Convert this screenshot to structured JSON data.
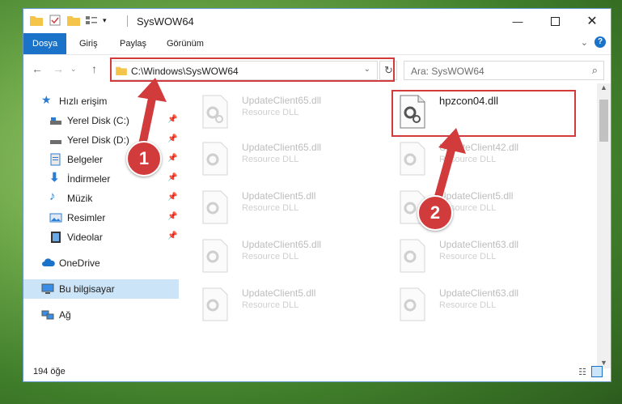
{
  "window": {
    "title": "SysWOW64"
  },
  "ribbon": {
    "tabs": [
      {
        "label": "Dosya"
      },
      {
        "label": "Giriş"
      },
      {
        "label": "Paylaş"
      },
      {
        "label": "Görünüm"
      }
    ]
  },
  "address": {
    "path": "C:\\Windows\\SysWOW64"
  },
  "search": {
    "placeholder": "Ara: SysWOW64"
  },
  "sidebar": {
    "items": [
      {
        "label": "Hızlı erişim",
        "icon": "star-icon"
      },
      {
        "label": "Yerel Disk (C:)",
        "icon": "drive-icon"
      },
      {
        "label": "Yerel Disk (D:)",
        "icon": "drive-icon"
      },
      {
        "label": "Belgeler",
        "icon": "documents-icon"
      },
      {
        "label": "İndirmeler",
        "icon": "download-icon"
      },
      {
        "label": "Müzik",
        "icon": "music-icon"
      },
      {
        "label": "Resimler",
        "icon": "pictures-icon"
      },
      {
        "label": "Videolar",
        "icon": "videos-icon"
      },
      {
        "label": "OneDrive",
        "icon": "cloud-icon"
      },
      {
        "label": "Bu bilgisayar",
        "icon": "computer-icon"
      },
      {
        "label": "Ağ",
        "icon": "network-icon"
      }
    ]
  },
  "files": [
    {
      "name": "UpdateClient65.dll",
      "type": "Resource DLL"
    },
    {
      "name": "hpzcon04.dll",
      "type": ""
    },
    {
      "name": "UpdateClient65.dll",
      "type": "Resource DLL"
    },
    {
      "name": "UpdateClient42.dll",
      "type": "Resource DLL"
    },
    {
      "name": "UpdateClient5.dll",
      "type": "Resource DLL"
    },
    {
      "name": "UpdateClient5.dll",
      "type": "Resource DLL"
    },
    {
      "name": "UpdateClient65.dll",
      "type": "Resource DLL"
    },
    {
      "name": "UpdateClient63.dll",
      "type": "Resource DLL"
    },
    {
      "name": "UpdateClient5.dll",
      "type": "Resource DLL"
    },
    {
      "name": "UpdateClient63.dll",
      "type": "Resource DLL"
    }
  ],
  "status": {
    "item_count": "194 öğe"
  },
  "annotations": {
    "badge1": "1",
    "badge2": "2"
  },
  "colors": {
    "accent": "#1a73c8",
    "annotation_red": "#d23b3b"
  }
}
